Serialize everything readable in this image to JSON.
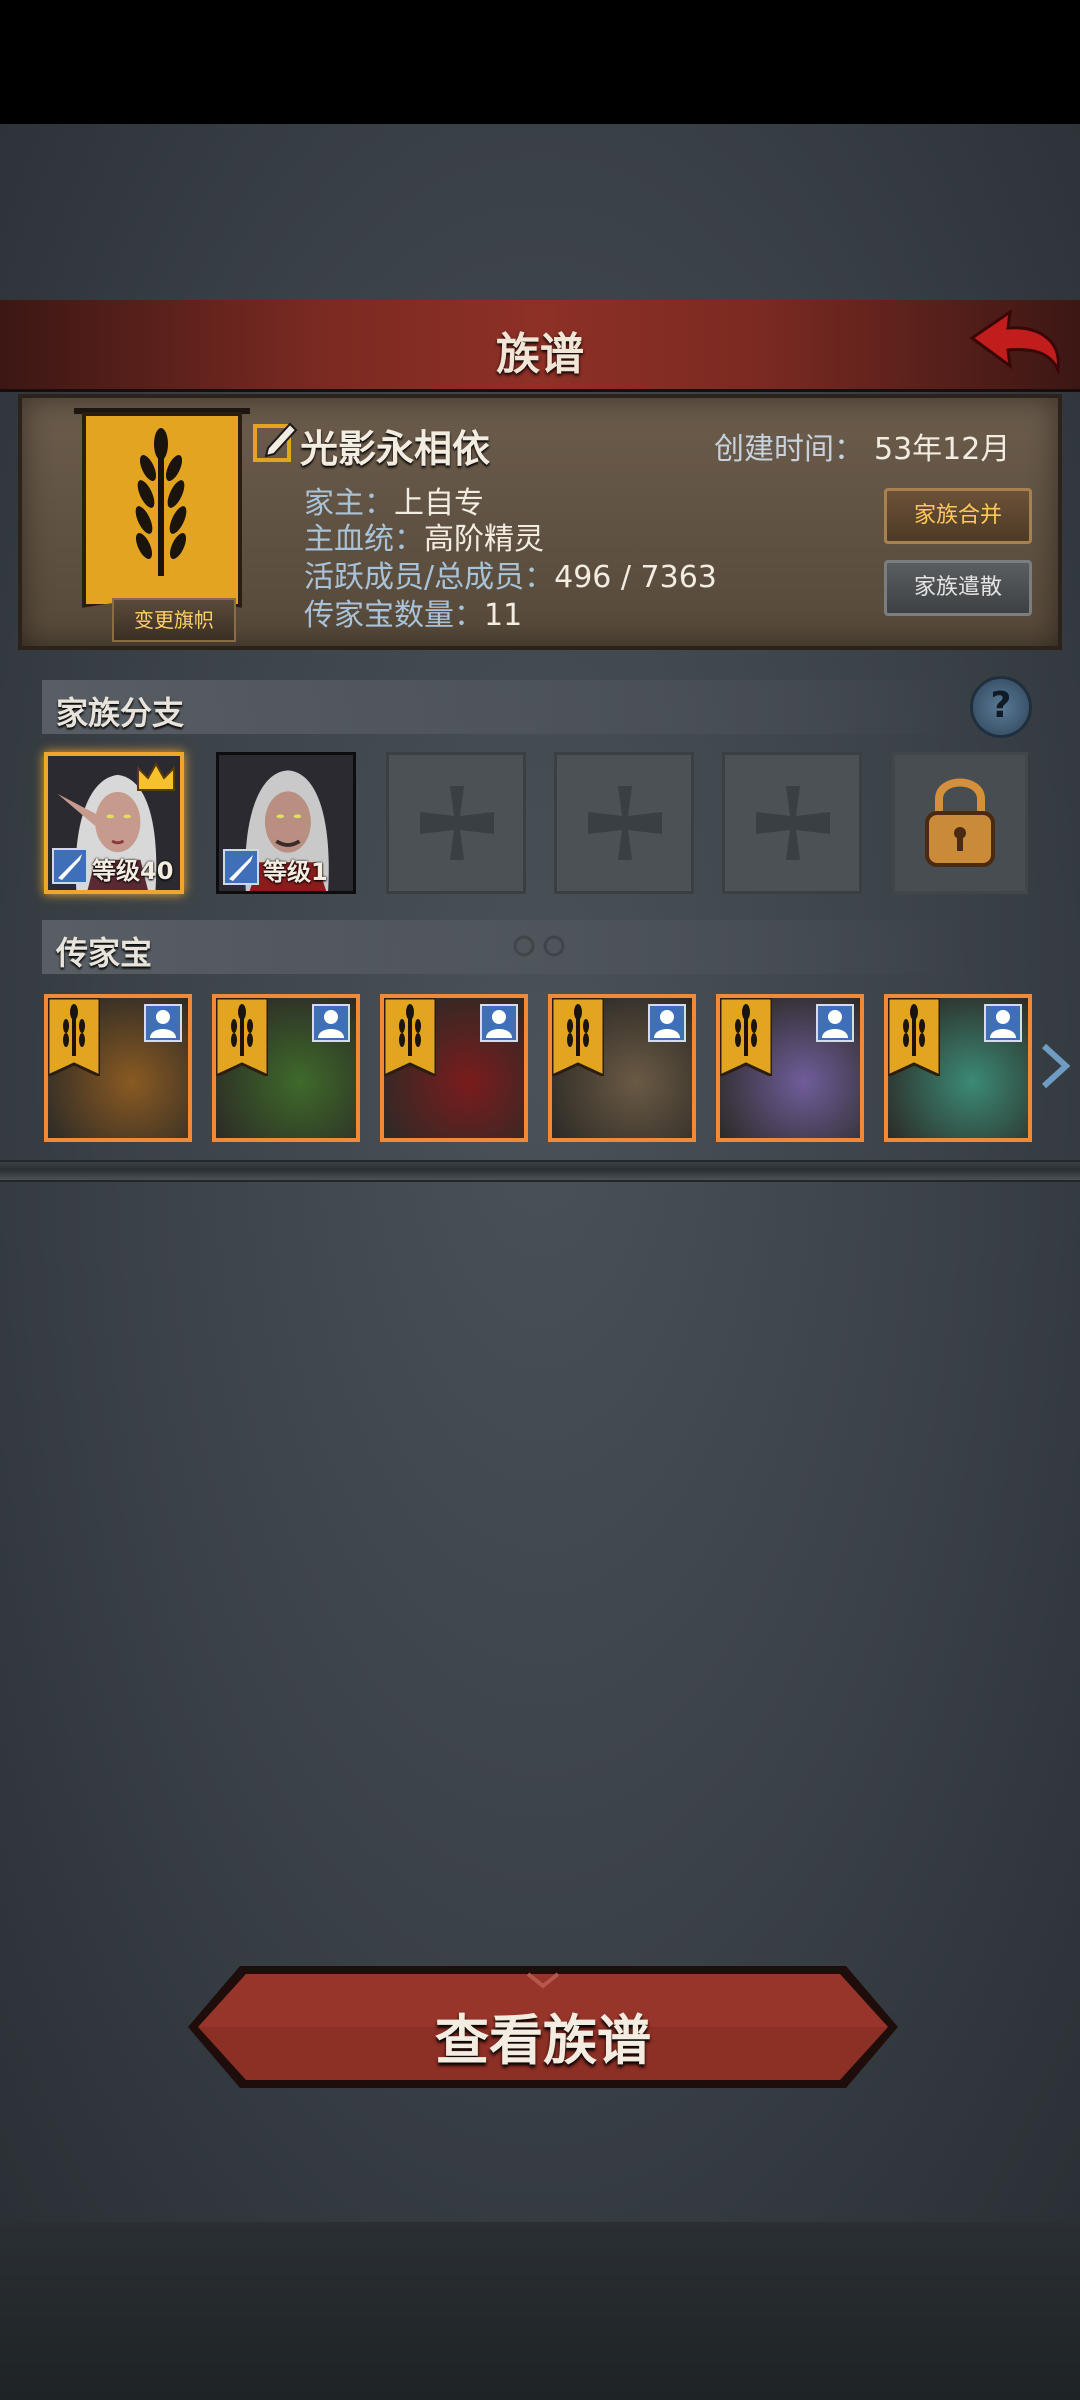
{
  "header": {
    "title": "族谱"
  },
  "family": {
    "name": "光影永相依",
    "created_label": "创建时间：",
    "created_value": "53年12月",
    "rows": [
      {
        "label": "家主：",
        "value": "上自专"
      },
      {
        "label": "主血统：",
        "value": "高阶精灵"
      },
      {
        "label": "活跃成员/总成员：",
        "value": "496 / 7363"
      },
      {
        "label": "传家宝数量：",
        "value": "11"
      }
    ],
    "change_banner_label": "变更旗帜",
    "merge_label": "家族合并",
    "disband_label": "家族遣散"
  },
  "branches": {
    "title": "家族分支",
    "help_label": "?",
    "members": [
      {
        "level_label": "等级40",
        "leader": true
      },
      {
        "level_label": "等级1",
        "leader": false
      }
    ]
  },
  "heirlooms": {
    "title": "传家宝",
    "items": [
      {
        "name": "heirloom-1",
        "color": "#8a5a22"
      },
      {
        "name": "heirloom-2",
        "color": "#3e6a2a"
      },
      {
        "name": "heirloom-3",
        "color": "#7a1c1c"
      },
      {
        "name": "heirloom-4",
        "color": "#6a5a44"
      },
      {
        "name": "heirloom-5",
        "color": "#6f5d9a"
      },
      {
        "name": "heirloom-6",
        "color": "#3b8a76"
      }
    ]
  },
  "footer": {
    "view_button_label": "查看族谱"
  },
  "colors": {
    "accent": "#e3a51f",
    "title_bar": "#8e3026",
    "slot_border": "#ee8a3a"
  }
}
